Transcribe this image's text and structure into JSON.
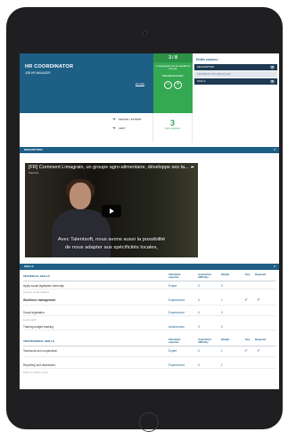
{
  "header": {
    "title": "HR COORDINATOR",
    "subtitle": "JOB HR MANAGER",
    "link": "job offer",
    "flow": [
      "SENIOR / EXPERT",
      "VERY"
    ]
  },
  "match": {
    "count": "3 / 8",
    "text": "3 employee(s) can be upskilled to this role",
    "label": "Recruitment levels",
    "score": "3",
    "score_label": "Open positions"
  },
  "profile": {
    "heading": "Profile sections :",
    "items": [
      {
        "label": "DESCRIPTION",
        "eye": "👁"
      },
      {
        "label": "TESTIMONY OF SKILLS (4/5)",
        "eye": ""
      },
      {
        "label": "SKILLS",
        "eye": "👁"
      }
    ]
  },
  "description": {
    "label": "DESCRIPTION",
    "toggle": "×"
  },
  "video": {
    "title": "[FR] Comment Limagrain, un groupe agro-alimentaire, développe ses ta...",
    "channel": "Talentsoft",
    "share": "➦",
    "caption1": "Avec Talentsoft, nous avons aussi la possibilité",
    "caption2": "de nous adapter aux spécificités locales,"
  },
  "skills_bar": {
    "label": "SKILLS",
    "toggle": "×"
  },
  "skills": {
    "headers": {
      "standard": "Standards required",
      "acquisition": "Acquisition difficulty",
      "weight": "Weight",
      "key": "Key",
      "required": "Required"
    },
    "technical": {
      "title": "TECHNICAL SKILLS",
      "rows": [
        {
          "name": "Apply social legislation internally",
          "standard": "Expert",
          "acq": "0",
          "weight": "0",
          "key": "",
          "req": "",
          "note": "Improve social relations"
        },
        {
          "name": "Workforce management",
          "standard": "Experienced",
          "acq": "5",
          "weight": "1",
          "key": "✓",
          "req": "✓",
          "note": ""
        },
        {
          "name": "Social legislation",
          "standard": "Experienced",
          "acq": "0",
          "weight": "0",
          "key": "",
          "req": "",
          "note": "Legal watch"
        },
        {
          "name": "Training budget tracking",
          "standard": "Autonomous",
          "acq": "0",
          "weight": "0",
          "key": "",
          "req": "",
          "note": ""
        }
      ]
    },
    "transversal": {
      "title": "TRANSVERSAL SKILLS",
      "rows": [
        {
          "name": "Teamwork and cooperation",
          "standard": "Expert",
          "acq": "0",
          "weight": "1",
          "key": "✓",
          "req": "✓",
          "note": ""
        },
        {
          "name": "Reporting and dashboard",
          "standard": "Experienced",
          "acq": "0",
          "weight": "1",
          "key": "",
          "req": "",
          "note": "Draw up activity report"
        }
      ]
    }
  }
}
